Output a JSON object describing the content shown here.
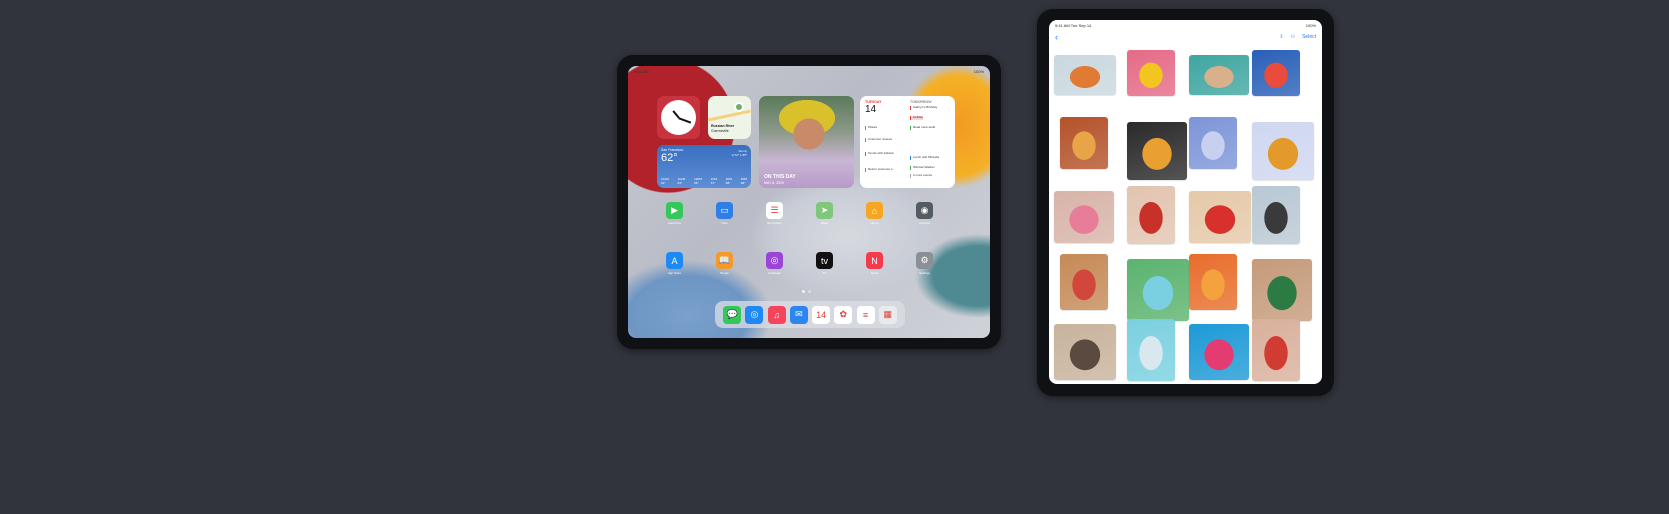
{
  "landscape_ipad": {
    "statusbar": {
      "time": "9:41 AM",
      "date": "Mon Jun 7",
      "battery": "100%"
    },
    "maps_widget": {
      "name": "Russian River",
      "sub": "Guerneville"
    },
    "photo_widget": {
      "title": "ON THIS DAY",
      "date": "MAY 8, 2020"
    },
    "calendar_widget": {
      "today_label": "TUESDAY",
      "today_num": "14",
      "tomorrow_label": "TOMORROW",
      "events": [
        "Pilates",
        "Customer reviews",
        "Tennis with Fabiola",
        "Return customer s..."
      ],
      "tomorrow_events": [
        "Kathryn's Birthday",
        "Holiday",
        "Read more audit",
        "Lunch with Miranda",
        "Window Washer",
        "2 more events"
      ]
    },
    "weather_widget": {
      "city": "San Francisco",
      "temp": "62°",
      "condition": "Sunny",
      "hilo": "H:72° L:55°",
      "hours": [
        "10AM",
        "11AM",
        "12PM",
        "1PM",
        "2PM",
        "3PM"
      ],
      "hour_temps": [
        "62°",
        "64°",
        "66°",
        "67°",
        "68°",
        "68°"
      ]
    },
    "apps_row1": [
      {
        "name": "FaceTime",
        "color": "#35c759",
        "glyph": "▶"
      },
      {
        "name": "Files",
        "color": "#2e7ee6",
        "glyph": "▭"
      },
      {
        "name": "Reminders",
        "color": "#ffffff",
        "glyph": "☰"
      },
      {
        "name": "Maps",
        "color": "#7fc77a",
        "glyph": "➤"
      },
      {
        "name": "Home",
        "color": "#f6a623",
        "glyph": "⌂"
      },
      {
        "name": "Camera",
        "color": "#555b63",
        "glyph": "◉"
      }
    ],
    "apps_row2": [
      {
        "name": "App Store",
        "color": "#1e88f5",
        "glyph": "A"
      },
      {
        "name": "Books",
        "color": "#f49a2a",
        "glyph": "📖"
      },
      {
        "name": "Podcasts",
        "color": "#9b45d6",
        "glyph": "◎"
      },
      {
        "name": "TV",
        "color": "#111111",
        "glyph": "tv"
      },
      {
        "name": "News",
        "color": "#f33b4c",
        "glyph": "N"
      },
      {
        "name": "Settings",
        "color": "#8b8f96",
        "glyph": "⚙"
      }
    ],
    "dock": [
      {
        "name": "Messages",
        "color": "#34c759",
        "glyph": "💬"
      },
      {
        "name": "Safari",
        "color": "#1e88f5",
        "glyph": "◎"
      },
      {
        "name": "Music",
        "color": "#f6445d",
        "glyph": "♫"
      },
      {
        "name": "Mail",
        "color": "#2d86f0",
        "glyph": "✉"
      },
      {
        "name": "Calendar",
        "color": "#ffffff",
        "glyph": "14"
      },
      {
        "name": "Photos",
        "color": "#ffffff",
        "glyph": "✿"
      },
      {
        "name": "Notes",
        "color": "#ffffff",
        "glyph": "≡"
      },
      {
        "name": "App Library",
        "color": "#e9eaee",
        "glyph": "▦"
      }
    ]
  },
  "portrait_ipad": {
    "statusbar": {
      "time": "9:41 AM",
      "date": "Tue Sep 14",
      "battery": "100%"
    },
    "toolbar": {
      "back": "‹",
      "select": "Select"
    },
    "photos": [
      {
        "colors": [
          "#c9d8df",
          "#e07a34"
        ]
      },
      {
        "colors": [
          "#e66a86",
          "#f3c520"
        ]
      },
      {
        "colors": [
          "#3fa6a0",
          "#d9b08c"
        ]
      },
      {
        "colors": [
          "#2a5fb8",
          "#e94b3c"
        ]
      },
      {
        "colors": [
          "#b4522a",
          "#e8a548"
        ]
      },
      {
        "colors": [
          "#2a2a2a",
          "#e9a031"
        ]
      },
      {
        "colors": [
          "#7d95d8",
          "#c7d1ef"
        ]
      },
      {
        "colors": [
          "#cfd7f0",
          "#e39a2a"
        ]
      },
      {
        "colors": [
          "#d8b4a8",
          "#e87d9a"
        ]
      },
      {
        "colors": [
          "#e2c4b0",
          "#c8312a"
        ]
      },
      {
        "colors": [
          "#e5c9a8",
          "#d7302d"
        ]
      },
      {
        "colors": [
          "#b9c8d4",
          "#3a3a3a"
        ]
      },
      {
        "colors": [
          "#c58a57",
          "#d2463b"
        ]
      },
      {
        "colors": [
          "#5bb36e",
          "#7ad0e0"
        ]
      },
      {
        "colors": [
          "#e86d2b",
          "#f4a23d"
        ]
      },
      {
        "colors": [
          "#c59b7a",
          "#2c7a44"
        ]
      },
      {
        "colors": [
          "#c8b39c",
          "#5a4a40"
        ]
      },
      {
        "colors": [
          "#7ad0e0",
          "#d8e8ee"
        ]
      },
      {
        "colors": [
          "#1d9ad6",
          "#e43b73"
        ]
      },
      {
        "colors": [
          "#d9b09c",
          "#d03b32"
        ]
      }
    ]
  }
}
